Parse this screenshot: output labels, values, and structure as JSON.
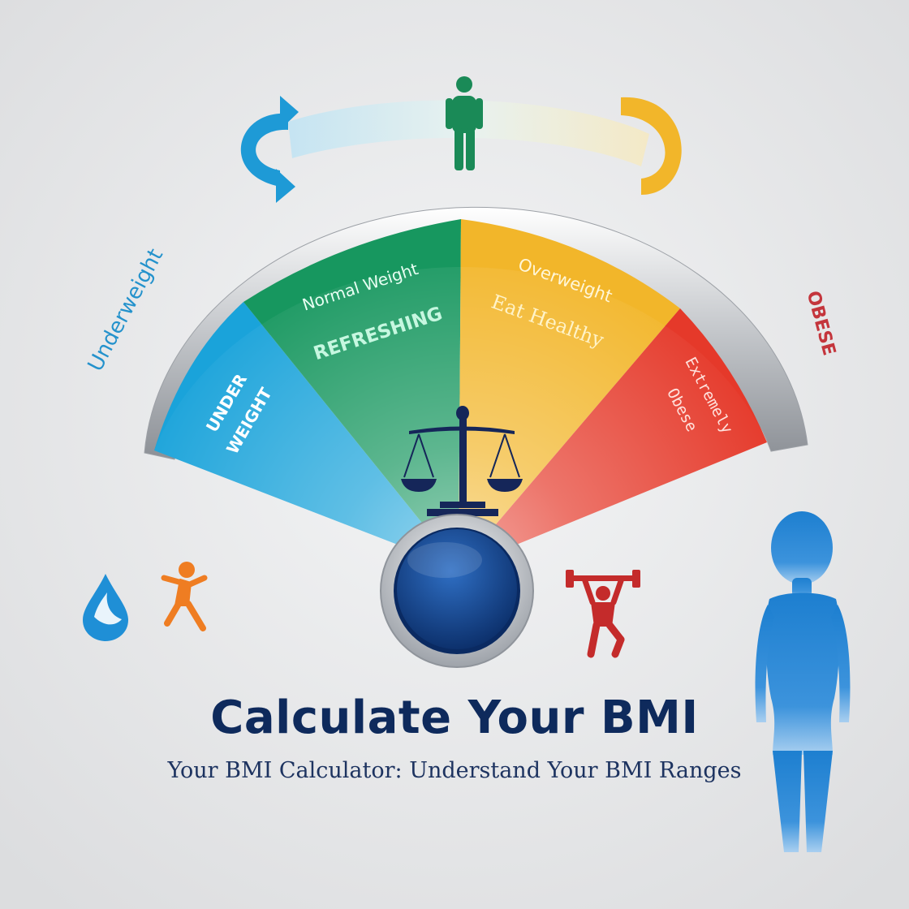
{
  "header": {
    "title": "Calculate Your BMI",
    "subtitle": "Your BMI Calculator: Understand Your BMI Ranges"
  },
  "gauge": {
    "outer_left_label": "Underweight",
    "outer_right_label": "OBESE",
    "segments": [
      {
        "id": "underweight",
        "lines": [
          "UNDER",
          "WEIGHT"
        ],
        "color": "#1aa3da"
      },
      {
        "id": "normal",
        "title": "Normal Weight",
        "tagline": "REFRESHING",
        "color": "#17975f"
      },
      {
        "id": "overweight",
        "title": "Overweight",
        "tagline": "Eat Healthy",
        "color": "#f2b62a"
      },
      {
        "id": "obese",
        "lines": [
          "Extremely",
          "Obese"
        ],
        "color": "#e5392a"
      }
    ]
  },
  "colors": {
    "background": "#e3e4e6",
    "title": "#0e2a5c",
    "person_top": "#1a8a57",
    "person_right": "#1d7fd0",
    "left_arrow": "#1e9ad6",
    "right_arrow": "#f2b62a",
    "scale": "#152659",
    "knob": "#0d3c85",
    "droplet": "#1f8fd6",
    "runner": "#ef7d22",
    "lifter": "#c42b2b"
  },
  "icons": [
    "droplet-icon",
    "runner-icon",
    "weightlifter-icon",
    "balance-scale-icon",
    "person-icon",
    "cycle-arrow-icon"
  ]
}
